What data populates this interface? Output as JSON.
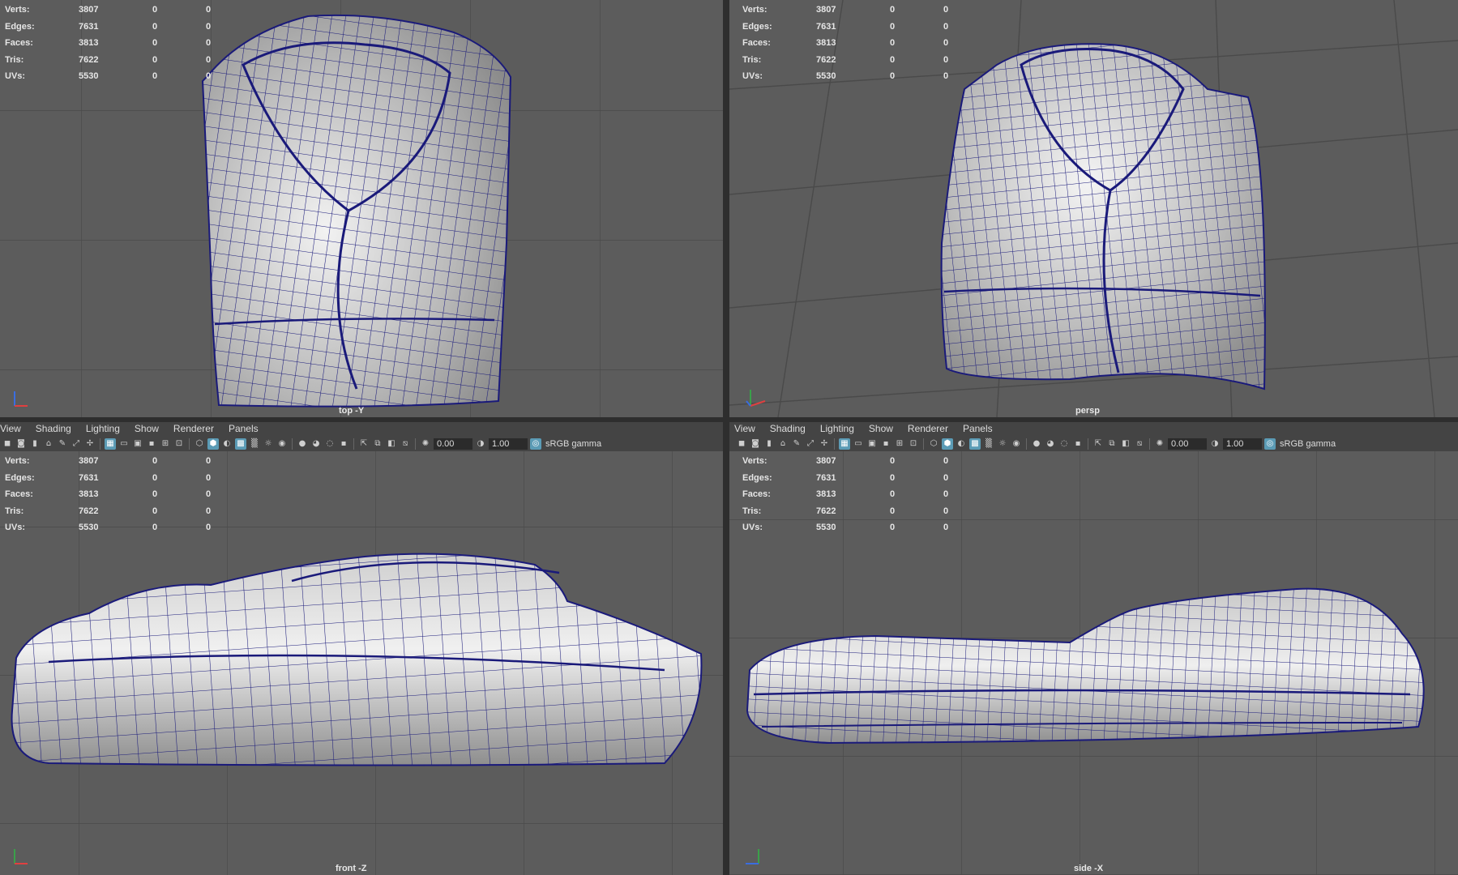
{
  "panel_menu": [
    "View",
    "Shading",
    "Lighting",
    "Show",
    "Renderer",
    "Panels"
  ],
  "stats": [
    {
      "label": "Verts:",
      "v1": "3807",
      "v2": "0",
      "v3": "0"
    },
    {
      "label": "Edges:",
      "v1": "7631",
      "v2": "0",
      "v3": "0"
    },
    {
      "label": "Faces:",
      "v1": "3813",
      "v2": "0",
      "v3": "0"
    },
    {
      "label": "Tris:",
      "v1": "7622",
      "v2": "0",
      "v3": "0"
    },
    {
      "label": "UVs:",
      "v1": "5530",
      "v2": "0",
      "v3": "0"
    }
  ],
  "toolbar": {
    "exposure": "0.00",
    "gamma_value": "1.00",
    "color_space": "sRGB gamma"
  },
  "viewports": {
    "top": {
      "camera": "top -Y"
    },
    "persp": {
      "camera": "persp"
    },
    "front": {
      "camera": "front -Z"
    },
    "side": {
      "camera": "side -X"
    }
  },
  "colors": {
    "wire": "#1a1a7a",
    "viewport_bg": "#5c5c5c",
    "grid": "#4a4a4a",
    "toolbar_active": "#5b9bb5"
  }
}
